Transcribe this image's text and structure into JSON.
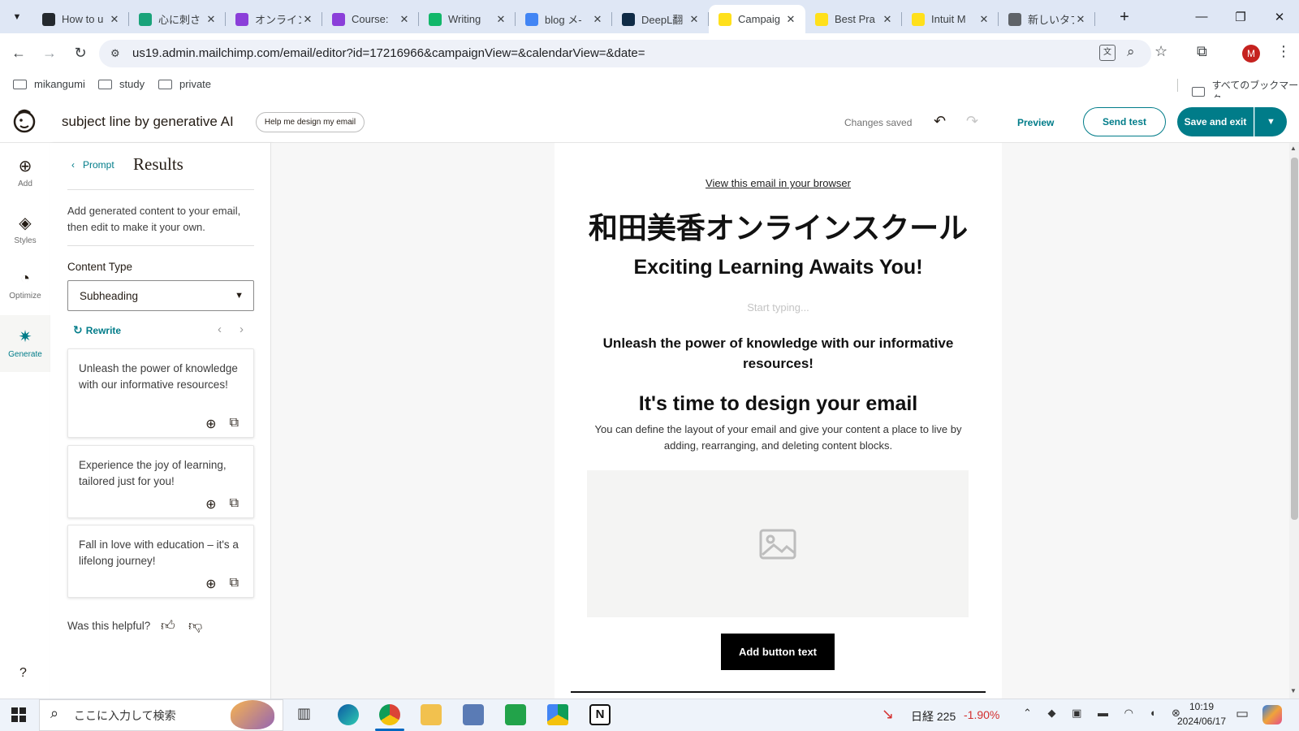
{
  "browser": {
    "tabs": [
      {
        "title": "How to u",
        "favicon": "star-logo-icon",
        "color": "#24292e"
      },
      {
        "title": "心に刺さ",
        "favicon": "bookmark-green-icon",
        "color": "#1aa37a"
      },
      {
        "title": "オンライン",
        "favicon": "purple-i-icon",
        "color": "#8b3fd9"
      },
      {
        "title": "Course:",
        "favicon": "purple-i-icon",
        "color": "#8b3fd9"
      },
      {
        "title": "Writing",
        "favicon": "green-chat-icon",
        "color": "#12b76a"
      },
      {
        "title": "blog メ-",
        "favicon": "docs-icon",
        "color": "#4285f4"
      },
      {
        "title": "DeepL翻",
        "favicon": "deepl-icon",
        "color": "#0f2b46"
      },
      {
        "title": "Campaig",
        "favicon": "mailchimp-icon",
        "color": "#ffe01b",
        "active": true
      },
      {
        "title": "Best Pra",
        "favicon": "mailchimp-icon",
        "color": "#ffe01b"
      },
      {
        "title": "Intuit M",
        "favicon": "mailchimp-icon",
        "color": "#ffe01b"
      },
      {
        "title": "新しいタブ",
        "favicon": "chrome-icon",
        "color": "#5f6368"
      }
    ],
    "url": "us19.admin.mailchimp.com/email/editor?id=17216966&campaignView=&calendarView=&date=",
    "profile_initial": "M",
    "bookmarks": [
      "mikangumi",
      "study",
      "private"
    ],
    "all_bookmarks": "すべてのブックマーク"
  },
  "app": {
    "title": "subject line by generative AI",
    "help_button": "Help me design my email",
    "status": "Changes saved",
    "preview": "Preview",
    "send_test": "Send test",
    "save_exit": "Save and exit",
    "accent": "#007c89"
  },
  "rail": [
    {
      "label": "Add",
      "icon": "plus-circle-icon"
    },
    {
      "label": "Styles",
      "icon": "paint-bucket-icon"
    },
    {
      "label": "Optimize",
      "icon": "gauge-icon"
    },
    {
      "label": "Generate",
      "icon": "sparkle-icon"
    }
  ],
  "rail_help": "?",
  "panel": {
    "back_label": "Prompt",
    "title": "Results",
    "description": "Add generated content to your email, then edit to make it your own.",
    "content_type_label": "Content Type",
    "content_type_value": "Subheading",
    "rewrite": "Rewrite",
    "results": [
      "Unleash the power of knowledge with our informative resources!",
      "Experience the joy of learning, tailored just for you!",
      "Fall in love with education – it's a lifelong journey!"
    ],
    "helpful": "Was this helpful?"
  },
  "email": {
    "view_browser": "View this email in your browser",
    "brand": "和田美香オンラインスクール",
    "headline": "Exciting Learning Awaits You!",
    "placeholder": "Start typing...",
    "subheading": "Unleash the power of knowledge with our informative resources!",
    "design_title": "It's time to design your email",
    "design_body": "You can define the layout of your email and give your content a place to live by adding, rearranging, and deleting content blocks.",
    "button_text": "Add button text"
  },
  "taskbar": {
    "search_placeholder": "ここに入力して検索",
    "stock_name": "日経 225",
    "stock_change": "-1.90%",
    "time": "10:19",
    "date": "2024/06/17"
  }
}
